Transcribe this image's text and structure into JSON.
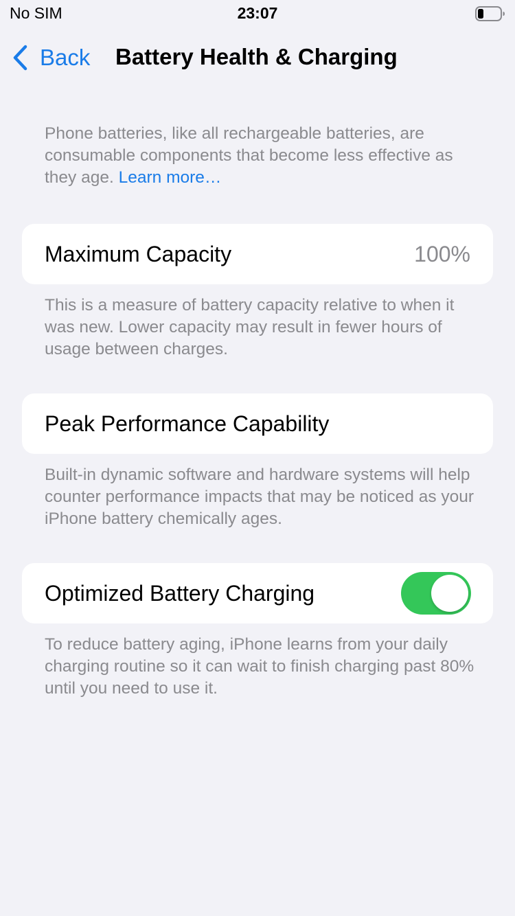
{
  "status_bar": {
    "carrier": "No SIM",
    "time": "23:07",
    "battery_icon": "battery-low-icon"
  },
  "nav": {
    "back_label": "Back",
    "back_icon": "chevron-left-icon",
    "title": "Battery Health & Charging"
  },
  "intro": {
    "text": "Phone batteries, like all rechargeable batteries, are consumable components that become less effective as they age. ",
    "link": "Learn more…"
  },
  "maximum_capacity": {
    "label": "Maximum Capacity",
    "value": "100%",
    "description": "This is a measure of battery capacity relative to when it was new. Lower capacity may result in fewer hours of usage between charges."
  },
  "peak_performance": {
    "label": "Peak Performance Capability",
    "description": "Built-in dynamic software and hardware systems will help counter performance impacts that may be noticed as your iPhone battery chemically ages."
  },
  "optimized_charging": {
    "label": "Optimized Battery Charging",
    "enabled": true,
    "description": "To reduce battery aging, iPhone learns from your daily charging routine so it can wait to finish charging past 80% until you need to use it."
  },
  "colors": {
    "accent": "#1a7ce8",
    "toggle_on": "#34c759",
    "background": "#f2f2f7",
    "secondary_text": "#8a8a8e"
  }
}
